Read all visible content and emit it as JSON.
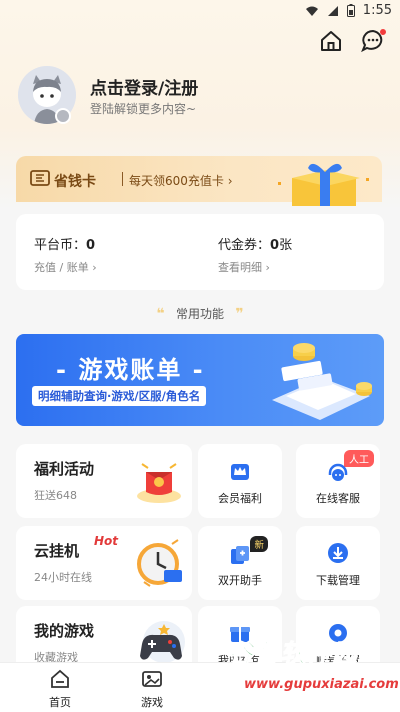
{
  "status_bar": {
    "time": "1:55"
  },
  "header": {
    "home_icon": "home-icon",
    "message_icon": "message-icon",
    "message_has_dot": true
  },
  "user": {
    "login_title": "点击登录/注册",
    "login_subtitle": "登陆解锁更多内容~"
  },
  "save_card": {
    "label": "省钱卡",
    "desc": "每天领600充值卡 ›"
  },
  "balance": {
    "coin_label": "平台币：",
    "coin_value": "0",
    "coin_links": "充值 / 账单 ›",
    "voucher_label": "代金券：",
    "voucher_value": "0",
    "voucher_unit": "张",
    "voucher_link": "查看明细 ›"
  },
  "section": {
    "title": "常用功能",
    "quote_left": "❝",
    "quote_right": "❞"
  },
  "banner": {
    "title": "- 游戏账单 -",
    "subtitle": "明细辅助查询·游戏/区服/角色名"
  },
  "tiles": {
    "welfare": {
      "title": "福利活动",
      "sub": "狂送648"
    },
    "member": {
      "label": "会员福利"
    },
    "service": {
      "label": "在线客服",
      "tag": "人工"
    },
    "idle": {
      "title": "云挂机",
      "hot": "Hot",
      "sub": "24小时在线"
    },
    "dual": {
      "label": "双开助手",
      "tag": "新"
    },
    "download": {
      "label": "下载管理"
    },
    "my_games": {
      "title": "我的游戏",
      "sub": "收藏游戏"
    },
    "gift": {
      "label": "我的礼包"
    },
    "account": {
      "label": "账号设置"
    }
  },
  "bottom_nav": {
    "home": "首页",
    "games": "游戏"
  },
  "watermark": {
    "text": "谷普软件园",
    "url": "www.gupuxiazai.com"
  },
  "colors": {
    "accent": "#2c6ff0",
    "gold": "#7a4a15",
    "red": "#f23c3c"
  }
}
